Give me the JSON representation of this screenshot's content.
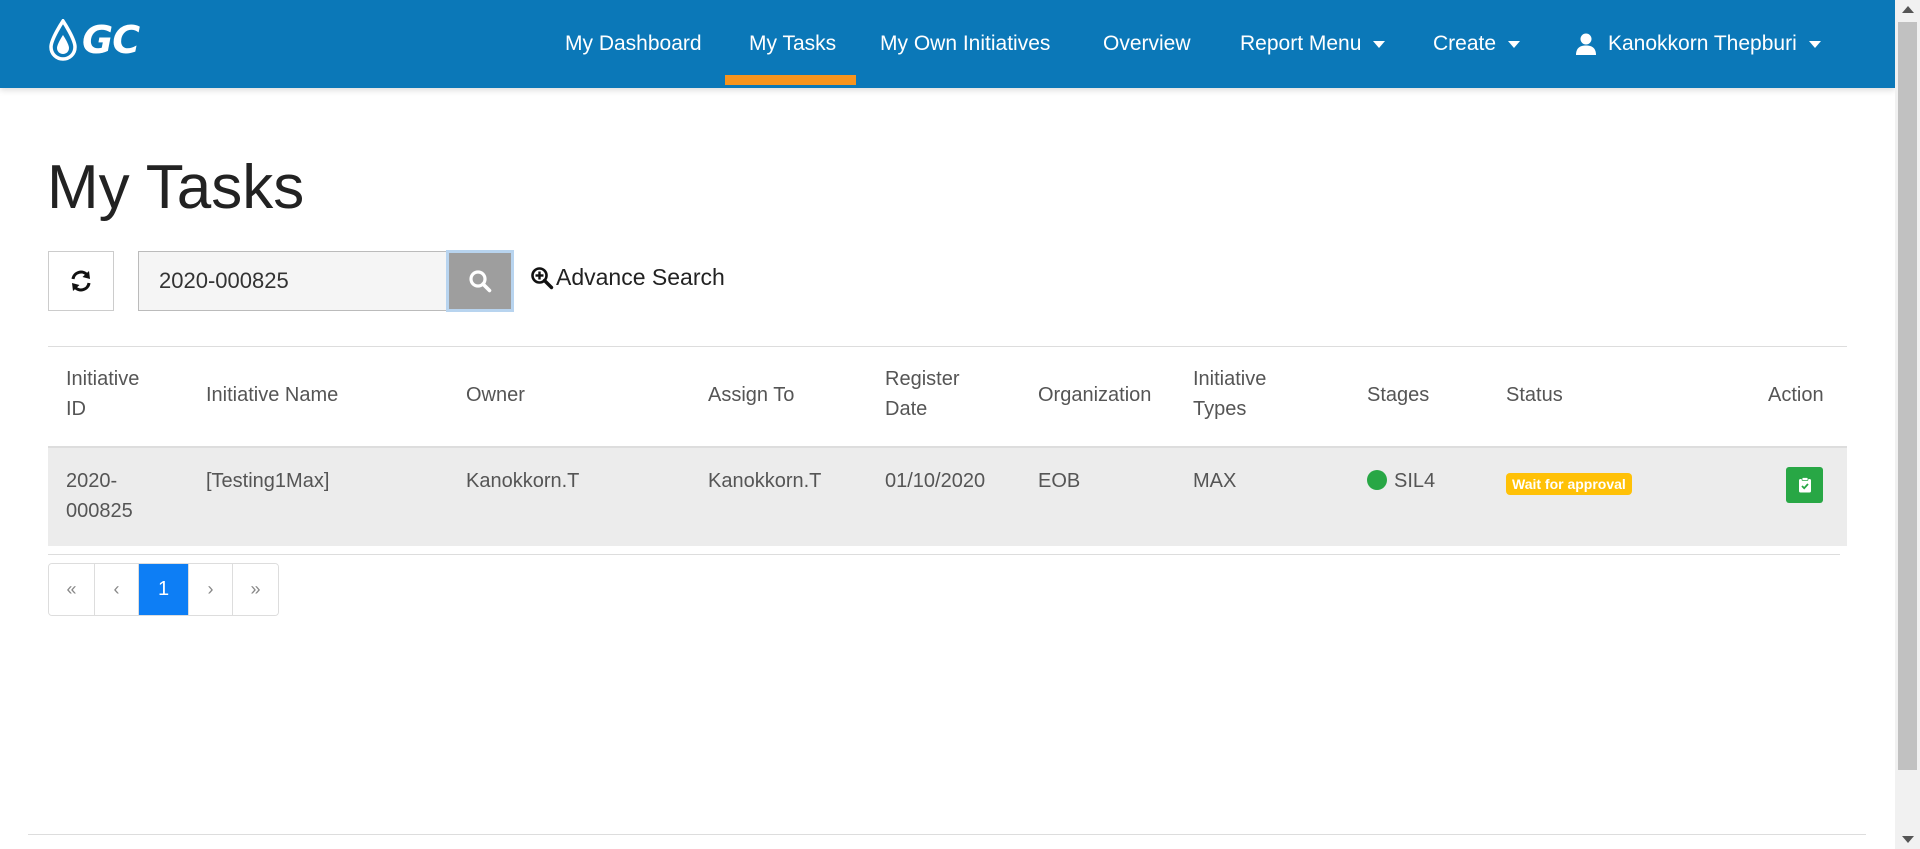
{
  "brand": {
    "logo_text": "GC"
  },
  "nav": {
    "items": [
      {
        "label": "My Dashboard"
      },
      {
        "label": "My Tasks"
      },
      {
        "label": "My Own Initiatives"
      },
      {
        "label": "Overview"
      },
      {
        "label": "Report Menu"
      },
      {
        "label": "Create"
      }
    ],
    "active": "My Tasks",
    "user_name": "Kanokkorn Thepburi"
  },
  "page": {
    "title": "My Tasks"
  },
  "search": {
    "value": "2020-000825",
    "advance_label": "Advance Search"
  },
  "table": {
    "headers": {
      "id_line1": "Initiative",
      "id_line2": "ID",
      "name": "Initiative Name",
      "owner": "Owner",
      "assign": "Assign To",
      "reg_line1": "Register",
      "reg_line2": "Date",
      "org": "Organization",
      "types_line1": "Initiative",
      "types_line2": "Types",
      "stages": "Stages",
      "status": "Status",
      "action": "Action"
    },
    "rows": [
      {
        "id_line1": "2020-",
        "id_line2": "000825",
        "name": "[Testing1Max]",
        "owner": "Kanokkorn.T",
        "assign": "Kanokkorn.T",
        "register_date": "01/10/2020",
        "organization": "EOB",
        "type": "MAX",
        "stage": "SIL4",
        "status": "Wait for approval"
      }
    ]
  },
  "pagination": {
    "first": "«",
    "prev": "‹",
    "current": "1",
    "next": "›",
    "last": "»"
  },
  "colors": {
    "navbar": "#0b78b8",
    "active_underline": "#f7941d",
    "stage_dot": "#28a745",
    "status_badge": "#ffc107",
    "action_button": "#28a745",
    "page_active": "#0d7ef5"
  },
  "icons": {
    "refresh": "refresh-icon",
    "search": "search-icon",
    "advance_search": "zoom-in-icon",
    "user": "user-icon",
    "action": "clipboard-check-icon"
  }
}
